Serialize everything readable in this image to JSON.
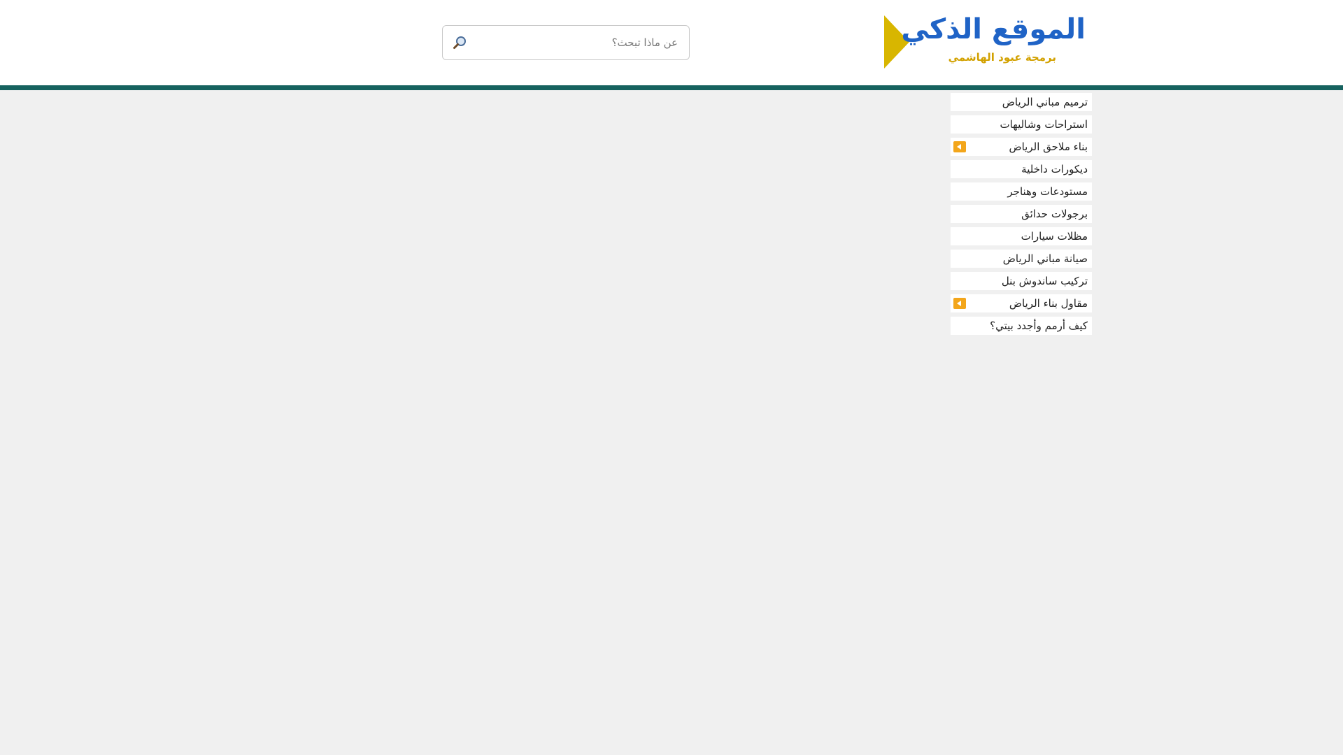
{
  "brand": {
    "title": "الموقع الذكي",
    "subtitle": "برمجة عبود الهاشمي",
    "title_color": "#1f63c6",
    "subtitle_color": "#d2a100",
    "arrow_color": "#d8b600"
  },
  "search": {
    "placeholder": "عن ماذا تبحث؟",
    "value": "",
    "icon": "magnifier-icon"
  },
  "header_bar_color": "#16625f",
  "menu": {
    "items": [
      {
        "label": "ترميم مباني الرياض",
        "has_submenu": false
      },
      {
        "label": "استراحات وشاليهات",
        "has_submenu": false
      },
      {
        "label": "بناء ملاحق الرياض",
        "has_submenu": true
      },
      {
        "label": "ديكورات داخلية",
        "has_submenu": false
      },
      {
        "label": "مستودعات وهناجر",
        "has_submenu": false
      },
      {
        "label": "برجولات حدائق",
        "has_submenu": false
      },
      {
        "label": "مظلات سيارات",
        "has_submenu": false
      },
      {
        "label": "صيانة مباني الرياض",
        "has_submenu": false
      },
      {
        "label": "تركيب ساندوش بنل",
        "has_submenu": false
      },
      {
        "label": "مقاول بناء الرياض",
        "has_submenu": true
      },
      {
        "label": "كيف أرمم وأجدد بيتي؟",
        "has_submenu": false
      }
    ],
    "submenu_icon": "triangle-left-icon",
    "submenu_icon_color": "#f3a61b"
  }
}
